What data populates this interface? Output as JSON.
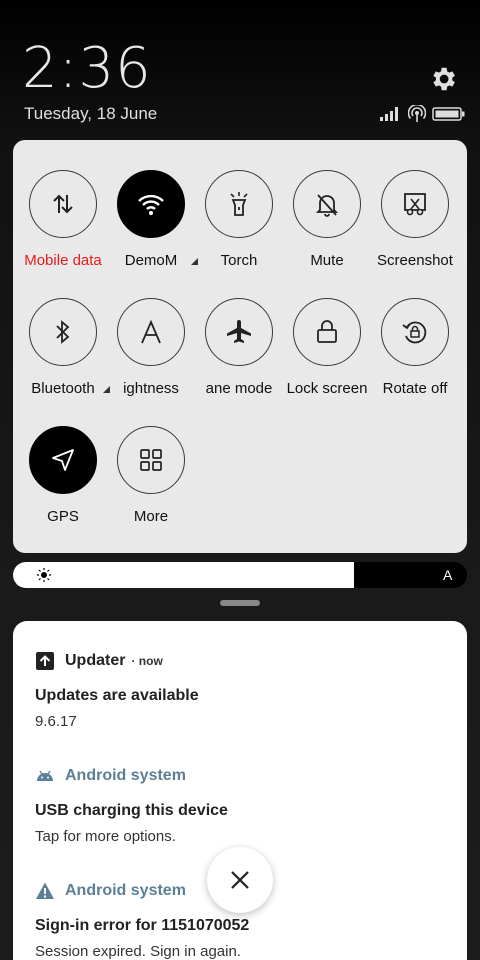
{
  "lockscreen": {
    "time": "2:36",
    "date": "Tuesday, 18 June"
  },
  "status_bar": {
    "icons": [
      "signal-icon",
      "wifi-hotspot-icon",
      "battery-icon"
    ]
  },
  "quick_settings": {
    "tiles": [
      {
        "label": "Mobile data",
        "icon": "data-arrows-icon",
        "active": false,
        "label_color": "#e81c1c"
      },
      {
        "label": "DemoM",
        "icon": "wifi-icon",
        "active": true
      },
      {
        "label": "Torch",
        "icon": "torch-icon",
        "active": false
      },
      {
        "label": "Mute",
        "icon": "bell-off-icon",
        "active": false
      },
      {
        "label": "Screenshot",
        "icon": "screenshot-icon",
        "active": false
      },
      {
        "label": "Bluetooth",
        "icon": "bluetooth-icon",
        "active": false
      },
      {
        "label": "ightness",
        "icon": "auto-brightness-icon",
        "active": false
      },
      {
        "label": "ane mode",
        "icon": "airplane-icon",
        "active": false
      },
      {
        "label": "Lock screen",
        "icon": "lock-icon",
        "active": false
      },
      {
        "label": "Rotate off",
        "icon": "rotate-lock-icon",
        "active": false
      },
      {
        "label": "GPS",
        "icon": "navigation-icon",
        "active": true
      },
      {
        "label": "More",
        "icon": "grid-icon",
        "active": false
      }
    ]
  },
  "brightness": {
    "level": 0.75,
    "auto_label": "A"
  },
  "notifications": [
    {
      "app": "Updater",
      "time": "now",
      "title": "Updates are available",
      "body": "9.6.17",
      "icon": "update-arrow-icon"
    },
    {
      "app": "Android system",
      "title": "USB charging this device",
      "body": "Tap for more options.",
      "icon": "android-icon"
    },
    {
      "app": "Android system",
      "title": "Sign-in error for 1151070052",
      "body": "Session expired. Sign in again.",
      "icon": "warning-icon"
    }
  ],
  "colors": {
    "accent_red": "#e81c1c",
    "system_blue": "#5c7f98",
    "panel_bg": "#e9e9e9"
  }
}
